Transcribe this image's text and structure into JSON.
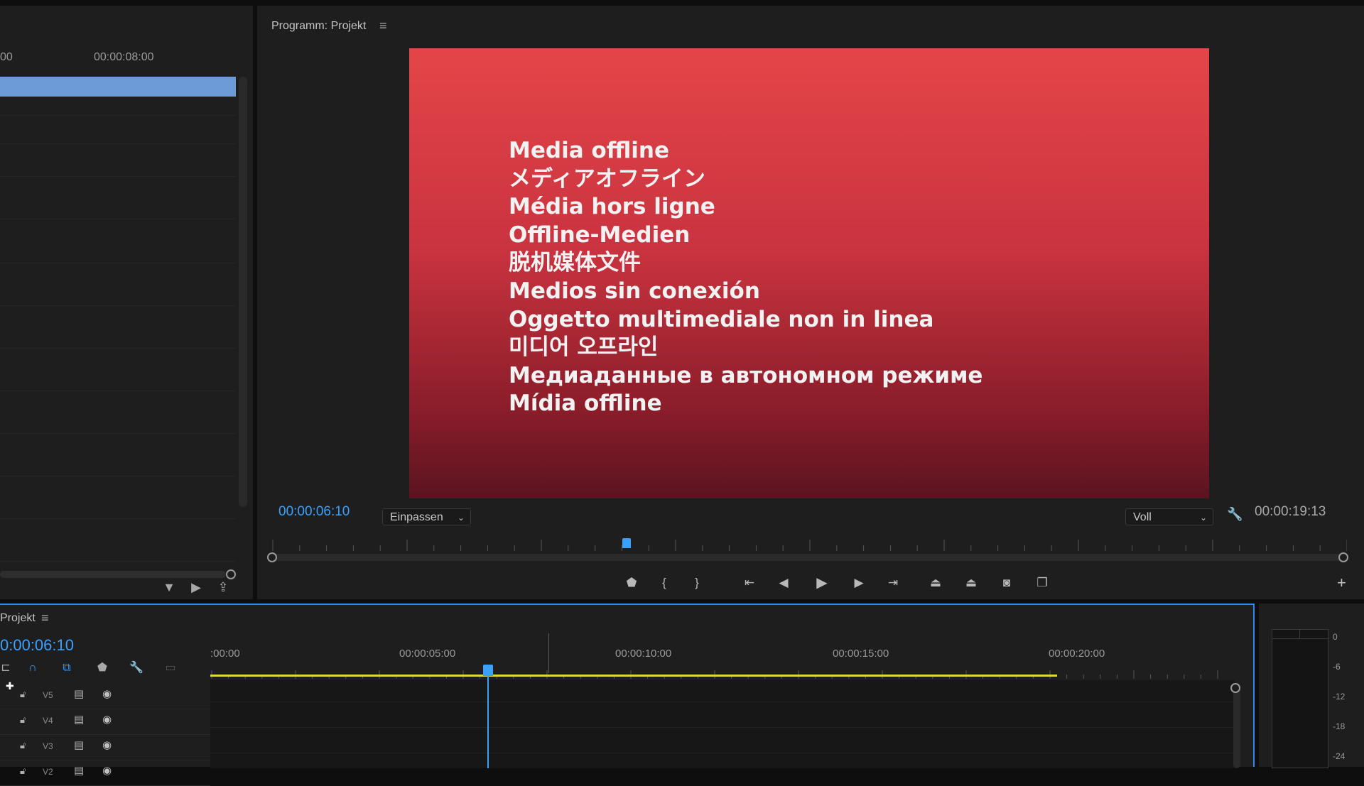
{
  "left_panel": {
    "ruler": {
      "partial_label": "00",
      "label": "00:00:08:00"
    }
  },
  "program_monitor": {
    "title": "Programm: Projekt",
    "menu_icon": "hamburger-menu-icon",
    "offline_messages": [
      "Media offline",
      "メディアオフライン",
      "Média hors ligne",
      "Offline-Medien",
      "脱机媒体文件",
      "Medios sin conexión",
      "Oggetto multimediale non in linea",
      "미디어 오프라인",
      "Медиаданные в автономном режиме",
      "Mídia offline"
    ],
    "current_time": "00:00:06:10",
    "zoom": "Einpassen",
    "quality": "Voll",
    "duration": "00:00:19:13",
    "playhead_fraction": 0.33
  },
  "timeline": {
    "title": "Projekt",
    "current_time": "0:00:06:10",
    "timecodes": [
      ":00:00",
      "00:00:05:00",
      "00:00:10:00",
      "00:00:15:00",
      "00:00:20:00"
    ],
    "tracks": [
      "V5",
      "V4",
      "V3",
      "V2"
    ]
  },
  "audio_meter": {
    "db_labels": [
      "0",
      "-6",
      "-12",
      "-18",
      "-24"
    ]
  },
  "colors": {
    "accent_blue": "#3aa1ff",
    "panel_bg": "#1e1e1e",
    "offline_red_top": "#e44548",
    "offline_red_bottom": "#5a1420",
    "clip_blue": "#6c9bd7",
    "work_area_yellow": "#e0d83a"
  }
}
